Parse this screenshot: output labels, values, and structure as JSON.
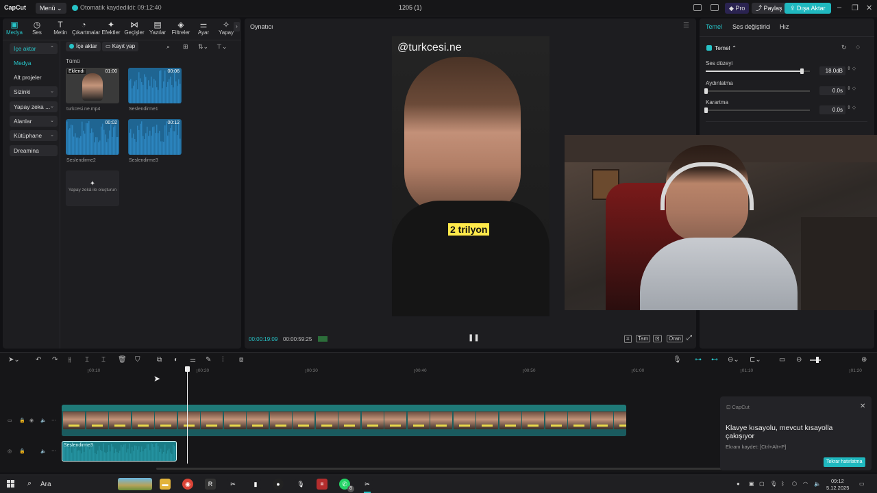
{
  "titlebar": {
    "logo": "CapCut",
    "menu": "Menü",
    "autosave": "Otomatik kaydedildi: 09:12:40",
    "project_title": "1205 (1)",
    "pro": "Pro",
    "share": "Paylaş",
    "export": "Dışa Aktar"
  },
  "toolbar_tabs": [
    {
      "label": "Medya",
      "icon": "media-icon",
      "glyph": "▣"
    },
    {
      "label": "Ses",
      "icon": "audio-icon",
      "glyph": "◷"
    },
    {
      "label": "Metin",
      "icon": "text-icon",
      "glyph": "T"
    },
    {
      "label": "Çıkartmalar",
      "icon": "sticker-icon",
      "glyph": "◔"
    },
    {
      "label": "Efektler",
      "icon": "effects-icon",
      "glyph": "✦"
    },
    {
      "label": "Geçişler",
      "icon": "transitions-icon",
      "glyph": "⋈"
    },
    {
      "label": "Yazılar",
      "icon": "captions-icon",
      "glyph": "▤"
    },
    {
      "label": "Filtreler",
      "icon": "filters-icon",
      "glyph": "◈"
    },
    {
      "label": "Ayar",
      "icon": "adjust-icon",
      "glyph": "⚌"
    },
    {
      "label": "Yapay",
      "icon": "ai-icon",
      "glyph": "✧"
    }
  ],
  "sidebar": {
    "items": [
      {
        "label": "İçe aktar",
        "active": true,
        "caret": "⌃"
      },
      {
        "label": "Medya",
        "active": true,
        "caret": ""
      },
      {
        "label": "Alt projeler",
        "caret": ""
      },
      {
        "label": "Sizinki",
        "caret": "⌄"
      },
      {
        "label": "Yapay zeka ...",
        "caret": "⌄"
      },
      {
        "label": "Alanlar",
        "caret": "⌄"
      },
      {
        "label": "Kütüphane",
        "caret": "⌄"
      },
      {
        "label": "Dreamina",
        "caret": ""
      }
    ]
  },
  "media": {
    "import_label": "İçe aktar",
    "record_label": "Kayıt yap",
    "all_label": "Tümü",
    "items": [
      {
        "name": "turkcesi.ne.mp4",
        "duration": "01:00",
        "tag": "Eklendi",
        "kind": "video"
      },
      {
        "name": "Seslendirme1",
        "duration": "00:06",
        "kind": "audio"
      },
      {
        "name": "Seslendirme2",
        "duration": "00:02",
        "kind": "audio"
      },
      {
        "name": "Seslendirme3",
        "duration": "00:12",
        "kind": "audio"
      }
    ],
    "generate_label": "Yapay zekâ ile oluşturun"
  },
  "player": {
    "title": "Oynatıcı",
    "watermark": "@turkcesi.ne",
    "caption": "2 trilyon",
    "time_current": "00:00:19:09",
    "time_total": "00:00:59:25",
    "full_label": "Tam",
    "ratio_label": "Oran"
  },
  "right_panel": {
    "tabs": [
      "Temel",
      "Ses değiştirici",
      "Hız"
    ],
    "section": "Temel",
    "params": [
      {
        "label": "Ses düzeyi",
        "value": "18.0dB",
        "level": 0.92
      },
      {
        "label": "Aydınlatma",
        "value": "0.0s",
        "level": 0
      },
      {
        "label": "Karartma",
        "value": "0.0s",
        "level": 0
      }
    ]
  },
  "timeline": {
    "ruler": [
      "00:10",
      "00:20",
      "00:30",
      "00:40",
      "00:50",
      "01:00",
      "01:10",
      "01:20"
    ],
    "audio_clip": "Seslendirme3",
    "playhead_time": "00:19"
  },
  "toast": {
    "brand": "CapCut",
    "title": "Klavye kısayolu, mevcut kısayolla çakışıyor",
    "subtitle": "Ekranı kaydet: [Ctrl+Alt+P]",
    "button": "Tekrar hatırlatma"
  },
  "taskbar": {
    "search": "Ara",
    "time": "09:12",
    "date": "5.12.2025",
    "badge": "8"
  },
  "colors": {
    "accent": "#27c3c7",
    "export": "#20b8bf",
    "caption_bg": "#ffe94a"
  }
}
